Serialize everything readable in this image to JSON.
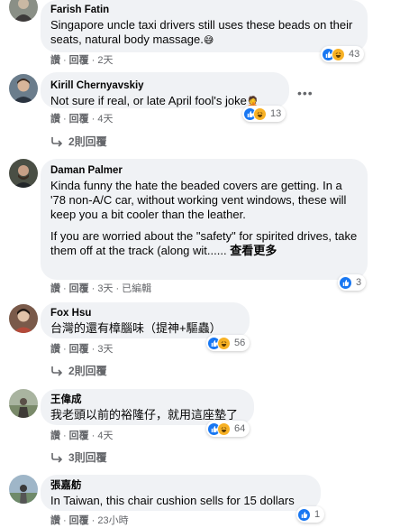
{
  "actions": {
    "like": "讚",
    "reply": "回覆",
    "edited": "已編輯",
    "see_more": "查看更多"
  },
  "comments": [
    {
      "author": "Farish Fatin",
      "text": "Singapore uncle taxi drivers still uses these beads on their seats, natural body massage.",
      "emoji": "😅",
      "time": "2天",
      "reaction_count": "43"
    },
    {
      "author": "Kirill Chernyavskiy",
      "text": "Not sure if real, or late April fool's joke",
      "emoji": "🤦",
      "time": "4天",
      "reaction_count": "13",
      "replies": "2則回覆"
    },
    {
      "author": "Daman Palmer",
      "text_p1": "Kinda funny the hate the beaded covers are getting. In a '78 non-A/C car, without working vent windows, these will keep you a bit cooler than the leather.",
      "text_p2": "If you are worried about the \"safety\" for spirited drives, take them off at the track (along wit......",
      "time": "3天",
      "reaction_count": "3"
    },
    {
      "author": "Fox Hsu",
      "text": "台灣的還有樟腦味（提神+驅蟲）",
      "time": "3天",
      "reaction_count": "56",
      "replies": "2則回覆"
    },
    {
      "author": "王偉成",
      "text": "我老頭以前的裕隆仔，就用這座墊了",
      "time": "4天",
      "reaction_count": "64",
      "replies": "3則回覆"
    },
    {
      "author": "張嘉舫",
      "text": "In Taiwan, this chair cushion sells for 15 dollars",
      "time": "23小時",
      "reaction_count": "1"
    }
  ],
  "colors": {
    "bubble": "#f0f2f5",
    "meta_text": "#65676b",
    "like_blue": "#1877f2",
    "haha_yellow": "#f7b125"
  },
  "icons": [
    "like-reaction-icon",
    "haha-reaction-icon",
    "reply-arrow-icon",
    "more-options-icon"
  ]
}
